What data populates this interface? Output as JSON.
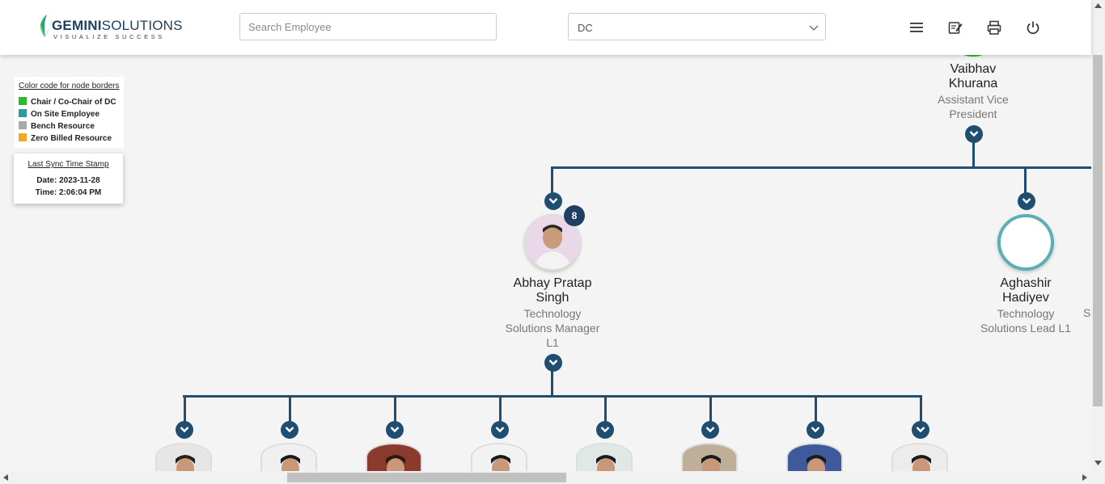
{
  "header": {
    "logo_brand_bold": "GEMINI",
    "logo_brand_rest": "SOLUTIONS",
    "logo_tagline": "VISUALIZE SUCCESS",
    "search_placeholder": "Search Employee",
    "dc_select_value": "DC",
    "icons": [
      "menu-icon",
      "edit-note-icon",
      "printer-icon",
      "power-icon"
    ]
  },
  "legend": {
    "title": "Color code for node borders",
    "items": [
      {
        "label": "Chair / Co-Chair of DC",
        "color": "#2db82d"
      },
      {
        "label": "On Site Employee",
        "color": "#2a9d9d"
      },
      {
        "label": "Bench Resource",
        "color": "#a9a9a9"
      },
      {
        "label": "Zero Billed Resource",
        "color": "#f5a623"
      }
    ]
  },
  "sync": {
    "title": "Last Sync Time Stamp",
    "date": "Date: 2023-11-28",
    "time": "Time: 2:06:04 PM"
  },
  "tree": {
    "root": {
      "name_line1": "Vaibhav",
      "name_line2": "Khurana",
      "title_line1": "Assistant Vice",
      "title_line2": "President",
      "border_color": "#2db82d"
    },
    "children": [
      {
        "name_line1": "Abhay Pratap",
        "name_line2": "Singh",
        "title_line1": "Technology",
        "title_line2": "Solutions Manager",
        "title_line3": "L1",
        "badge": "8"
      },
      {
        "name_line1": "Aghashir",
        "name_line2": "Hadiyev",
        "title_line1": "Technology",
        "title_line2": "Solutions Lead L1",
        "border_color": "#5cb0b3"
      }
    ],
    "grandchildren_count": 8
  },
  "colors": {
    "connector": "#1f4e70",
    "badge": "#1f3f64"
  }
}
